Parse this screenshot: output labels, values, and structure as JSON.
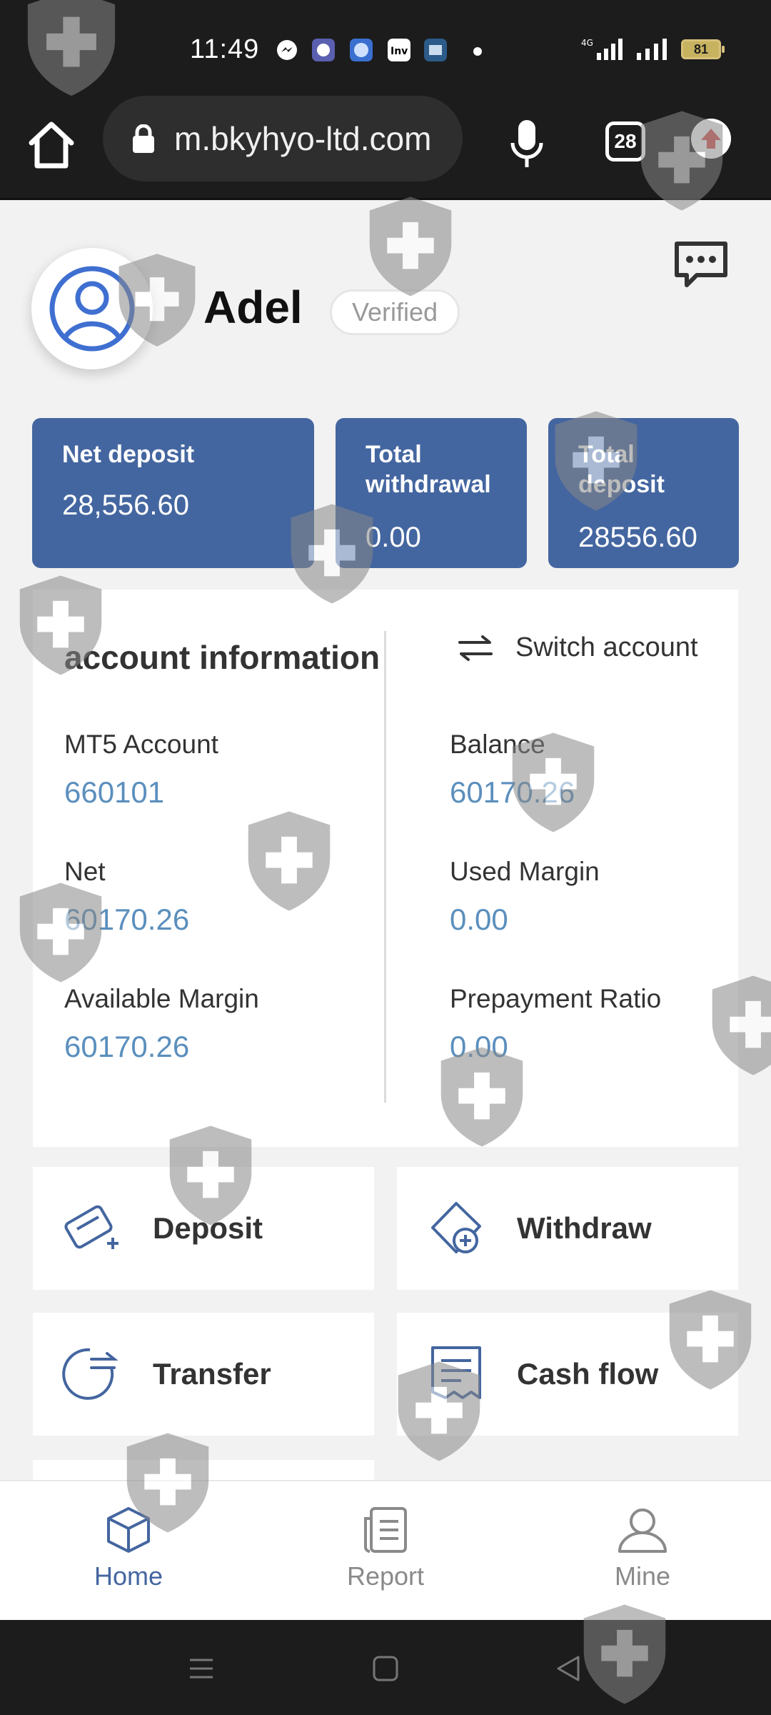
{
  "status_bar": {
    "time": "11:49",
    "notification_icons": [
      "messenger-icon",
      "app-icon",
      "app-icon",
      "investing-icon",
      "app-icon"
    ],
    "network": "4G",
    "battery": "81"
  },
  "browser": {
    "url": "m.bkyhyo-ltd.com",
    "tab_count": "28"
  },
  "profile": {
    "name": "Adel",
    "badge": "Verified"
  },
  "stats": [
    {
      "label": "Net deposit",
      "value": "28,556.60"
    },
    {
      "label": "Total withdrawal",
      "value": "0.00"
    },
    {
      "label": "Total deposit",
      "value": "28556.60"
    }
  ],
  "account": {
    "title": "account information",
    "switch_label": "Switch account",
    "fields_left": [
      {
        "label": "MT5 Account",
        "value": "660101"
      },
      {
        "label": "Net",
        "value": "60170.26"
      },
      {
        "label": "Available Margin",
        "value": "60170.26"
      }
    ],
    "fields_right": [
      {
        "label": "Balance",
        "value": "60170.26"
      },
      {
        "label": "Used Margin",
        "value": "0.00"
      },
      {
        "label": "Prepayment Ratio",
        "value": "0.00"
      }
    ]
  },
  "actions": {
    "deposit": "Deposit",
    "withdraw": "Withdraw",
    "transfer": "Transfer",
    "cash_flow": "Cash flow"
  },
  "bottom_nav": {
    "home": "Home",
    "report": "Report",
    "mine": "Mine",
    "active": "home"
  },
  "colors": {
    "accent": "#4466a0",
    "value_blue": "#5b8fbd",
    "nav_active": "#4466a0",
    "nav_inactive": "#8a8a8a"
  }
}
